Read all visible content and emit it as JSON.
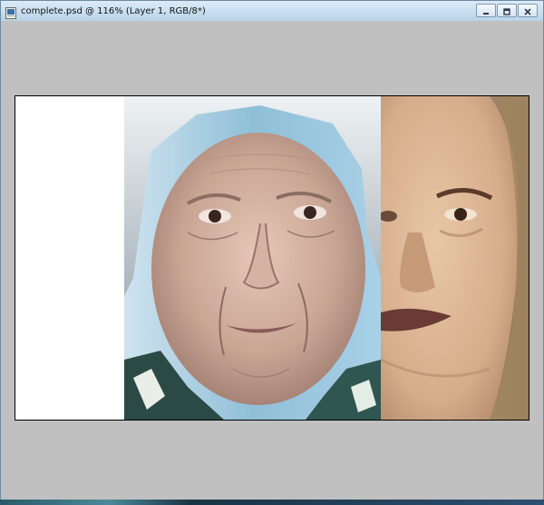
{
  "window": {
    "title": "complete.psd @ 116% (Layer 1, RGB/8*)",
    "icon": "photoshop-document-icon",
    "controls": [
      "minimize-icon",
      "maximize-icon",
      "close-icon"
    ]
  },
  "canvas": {
    "background": "#c0c0c0",
    "document_border": "#000000",
    "layers": [
      {
        "name": "white-area",
        "color": "#ffffff"
      },
      {
        "name": "elderly-woman-photo"
      },
      {
        "name": "painted-young-woman"
      }
    ]
  },
  "colors": {
    "titlebar_top": "#dcebf6",
    "titlebar_bottom": "#b8d2e9",
    "workspace": "#c0c0c0"
  }
}
